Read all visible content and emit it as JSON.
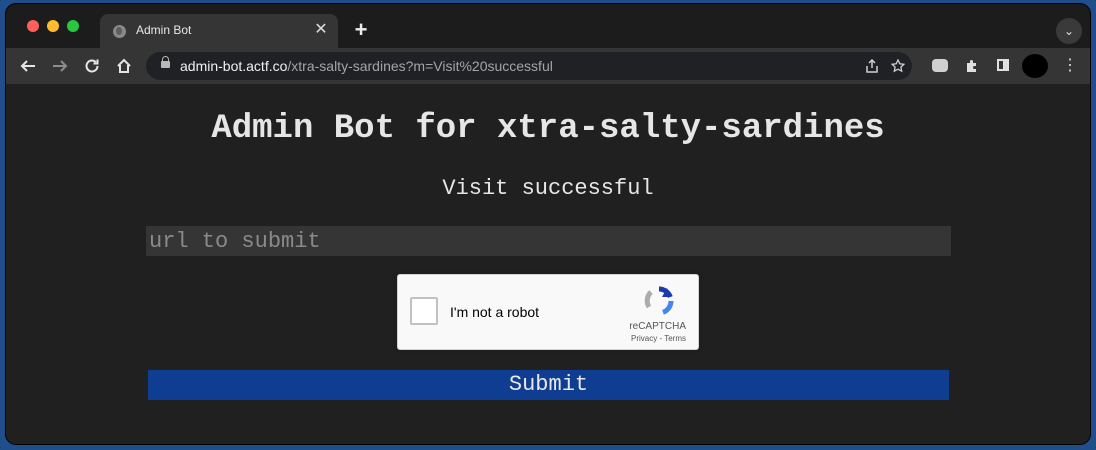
{
  "browser": {
    "tab": {
      "title": "Admin Bot",
      "close_glyph": "✕"
    },
    "new_tab_glyph": "+",
    "tab_search_glyph": "⌄",
    "address": {
      "host": "admin-bot.actf.co",
      "path": "/xtra-salty-sardines?m=Visit%20successful"
    }
  },
  "page": {
    "title": "Admin Bot for xtra-salty-sardines",
    "status": "Visit successful",
    "url_input_placeholder": "url to submit",
    "url_input_value": "",
    "recaptcha": {
      "label": "I'm not a robot",
      "brand": "reCAPTCHA",
      "links": "Privacy - Terms",
      "checked": false
    },
    "submit_label": "Submit"
  },
  "colors": {
    "page_bg": "#202020",
    "submit_bg": "#0e3d92",
    "input_bg": "#353535"
  }
}
